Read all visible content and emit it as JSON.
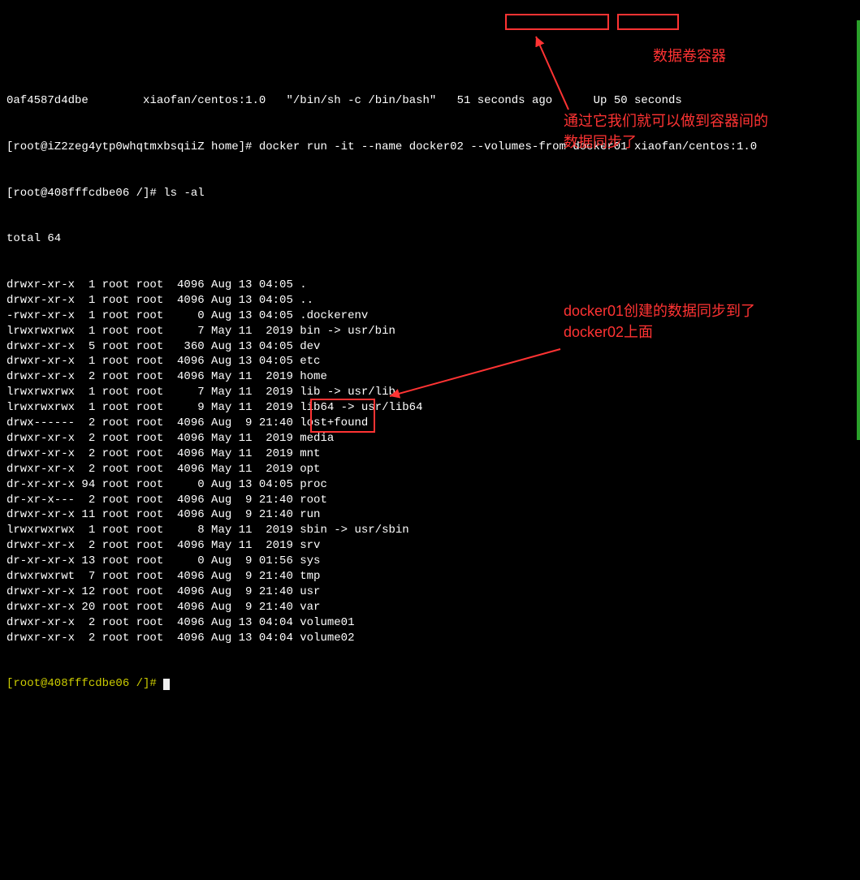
{
  "header": {
    "container_id": "0af4587d4dbe",
    "image": "xiaofan/centos:1.0",
    "command": "\"/bin/sh -c /bin/bash\"",
    "created": "51 seconds ago",
    "status": "Up 50 seconds"
  },
  "prompt1": {
    "user_host": "[root@iZ2zeg4ytp0whqtmxbsqiiZ home]#",
    "cmd": "docker run -it --name docker02",
    "flag": "--volumes-from",
    "src": "docker01",
    "image": "xiaofan/centos:1.0"
  },
  "prompt2": {
    "user_host": "[root@408fffcdbe06 /]#",
    "cmd": "ls -al"
  },
  "total": "total 64",
  "rows": [
    {
      "perm": "drwxr-xr-x",
      "nl": " 1",
      "own": "root root",
      "size": " 4096",
      "date": "Aug 13 04:05",
      "name": "."
    },
    {
      "perm": "drwxr-xr-x",
      "nl": " 1",
      "own": "root root",
      "size": " 4096",
      "date": "Aug 13 04:05",
      "name": ".."
    },
    {
      "perm": "-rwxr-xr-x",
      "nl": " 1",
      "own": "root root",
      "size": "    0",
      "date": "Aug 13 04:05",
      "name": ".dockerenv"
    },
    {
      "perm": "lrwxrwxrwx",
      "nl": " 1",
      "own": "root root",
      "size": "    7",
      "date": "May 11  2019",
      "name": "bin -> usr/bin"
    },
    {
      "perm": "drwxr-xr-x",
      "nl": " 5",
      "own": "root root",
      "size": "  360",
      "date": "Aug 13 04:05",
      "name": "dev"
    },
    {
      "perm": "drwxr-xr-x",
      "nl": " 1",
      "own": "root root",
      "size": " 4096",
      "date": "Aug 13 04:05",
      "name": "etc"
    },
    {
      "perm": "drwxr-xr-x",
      "nl": " 2",
      "own": "root root",
      "size": " 4096",
      "date": "May 11  2019",
      "name": "home"
    },
    {
      "perm": "lrwxrwxrwx",
      "nl": " 1",
      "own": "root root",
      "size": "    7",
      "date": "May 11  2019",
      "name": "lib -> usr/lib"
    },
    {
      "perm": "lrwxrwxrwx",
      "nl": " 1",
      "own": "root root",
      "size": "    9",
      "date": "May 11  2019",
      "name": "lib64 -> usr/lib64"
    },
    {
      "perm": "drwx------",
      "nl": " 2",
      "own": "root root",
      "size": " 4096",
      "date": "Aug  9 21:40",
      "name": "lost+found"
    },
    {
      "perm": "drwxr-xr-x",
      "nl": " 2",
      "own": "root root",
      "size": " 4096",
      "date": "May 11  2019",
      "name": "media"
    },
    {
      "perm": "drwxr-xr-x",
      "nl": " 2",
      "own": "root root",
      "size": " 4096",
      "date": "May 11  2019",
      "name": "mnt"
    },
    {
      "perm": "drwxr-xr-x",
      "nl": " 2",
      "own": "root root",
      "size": " 4096",
      "date": "May 11  2019",
      "name": "opt"
    },
    {
      "perm": "dr-xr-xr-x",
      "nl": "94",
      "own": "root root",
      "size": "    0",
      "date": "Aug 13 04:05",
      "name": "proc"
    },
    {
      "perm": "dr-xr-x---",
      "nl": " 2",
      "own": "root root",
      "size": " 4096",
      "date": "Aug  9 21:40",
      "name": "root"
    },
    {
      "perm": "drwxr-xr-x",
      "nl": "11",
      "own": "root root",
      "size": " 4096",
      "date": "Aug  9 21:40",
      "name": "run"
    },
    {
      "perm": "lrwxrwxrwx",
      "nl": " 1",
      "own": "root root",
      "size": "    8",
      "date": "May 11  2019",
      "name": "sbin -> usr/sbin"
    },
    {
      "perm": "drwxr-xr-x",
      "nl": " 2",
      "own": "root root",
      "size": " 4096",
      "date": "May 11  2019",
      "name": "srv"
    },
    {
      "perm": "dr-xr-xr-x",
      "nl": "13",
      "own": "root root",
      "size": "    0",
      "date": "Aug  9 01:56",
      "name": "sys"
    },
    {
      "perm": "drwxrwxrwt",
      "nl": " 7",
      "own": "root root",
      "size": " 4096",
      "date": "Aug  9 21:40",
      "name": "tmp"
    },
    {
      "perm": "drwxr-xr-x",
      "nl": "12",
      "own": "root root",
      "size": " 4096",
      "date": "Aug  9 21:40",
      "name": "usr"
    },
    {
      "perm": "drwxr-xr-x",
      "nl": "20",
      "own": "root root",
      "size": " 4096",
      "date": "Aug  9 21:40",
      "name": "var"
    },
    {
      "perm": "drwxr-xr-x",
      "nl": " 2",
      "own": "root root",
      "size": " 4096",
      "date": "Aug 13 04:04",
      "name": "volume01"
    },
    {
      "perm": "drwxr-xr-x",
      "nl": " 2",
      "own": "root root",
      "size": " 4096",
      "date": "Aug 13 04:04",
      "name": "volume02"
    }
  ],
  "prompt3": {
    "user_host": "[root@408fffcdbe06 /]#"
  },
  "annotations": {
    "top_label": "数据卷容器",
    "mid_line1": "通过它我们就可以做到容器间的",
    "mid_line2": "数据同步了",
    "bottom_line1": "docker01创建的数据同步到了",
    "bottom_line2": "docker02上面"
  },
  "colors": {
    "accent": "#ff3333"
  }
}
